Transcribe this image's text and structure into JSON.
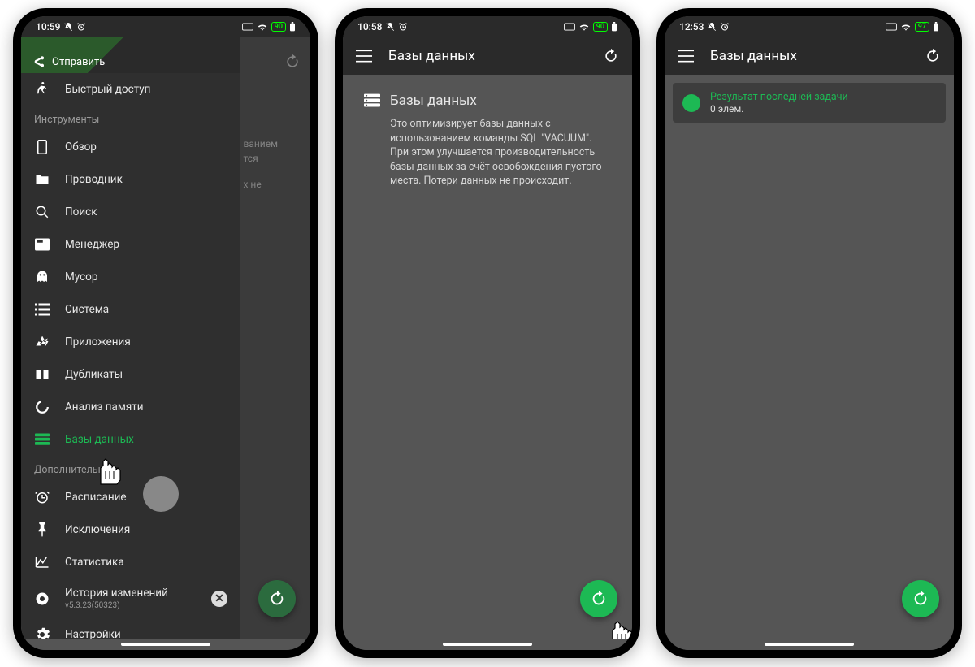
{
  "phone1": {
    "status_time": "10:59",
    "status_batt": "90",
    "share_label": "Отправить",
    "quick_access": "Быстрый доступ",
    "section_tools": "Инструменты",
    "items_tools": [
      "Обзор",
      "Проводник",
      "Поиск",
      "Менеджер",
      "Мусор",
      "Система",
      "Приложения",
      "Дубликаты",
      "Анализ памяти",
      "Базы данных"
    ],
    "section_extra": "Дополнительно",
    "items_extra": [
      "Расписание",
      "Исключения",
      "Статистика"
    ],
    "changelog_label": "История изменений",
    "changelog_ver": "v5.3.23(50323)",
    "settings_label": "Настройки",
    "bg_hint1": "ванием",
    "bg_hint2": "х не"
  },
  "phone2": {
    "status_time": "10:58",
    "status_batt": "90",
    "title": "Базы данных",
    "card_title": "Базы данных",
    "card_desc": "Это оптимизирует базы данных с использованием команды SQL \"VACUUM\". При этом улучшается производительность базы данных за счёт освобождения пустого места. Потери данных не происходит."
  },
  "phone3": {
    "status_time": "12:53",
    "status_batt": "97",
    "title": "Базы данных",
    "result_title": "Результат последней задачи",
    "result_sub": "0 элем."
  }
}
